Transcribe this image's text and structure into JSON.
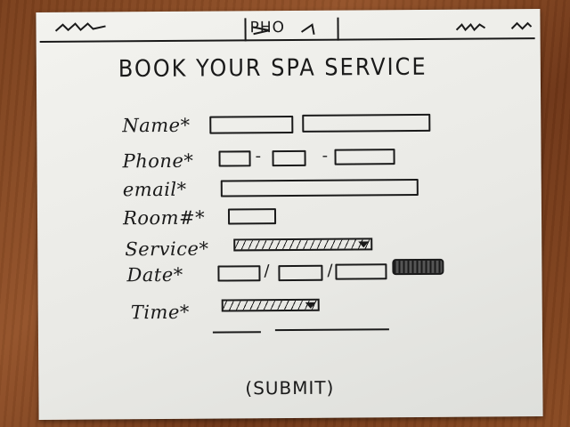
{
  "header": {
    "center_label": "PHO"
  },
  "form": {
    "title": "BOOK YOUR SPA SERVICE",
    "fields": {
      "name": "Name*",
      "phone": "Phone*",
      "email": "email*",
      "room": "Room#*",
      "service": "Service*",
      "date": "Date*",
      "time": "Time*"
    },
    "phone_separator": "-",
    "date_separator": "/",
    "submit_label": "(SUBMIT)"
  },
  "icons": {
    "header_left": "squiggle-icon",
    "header_right": "squiggle-icon",
    "dropdown": "chevron-down-icon",
    "date_picker": "calendar-icon"
  },
  "colors": {
    "ink": "#1a1a1a",
    "paper": "#efefeb",
    "table": "#7a3f1c"
  }
}
